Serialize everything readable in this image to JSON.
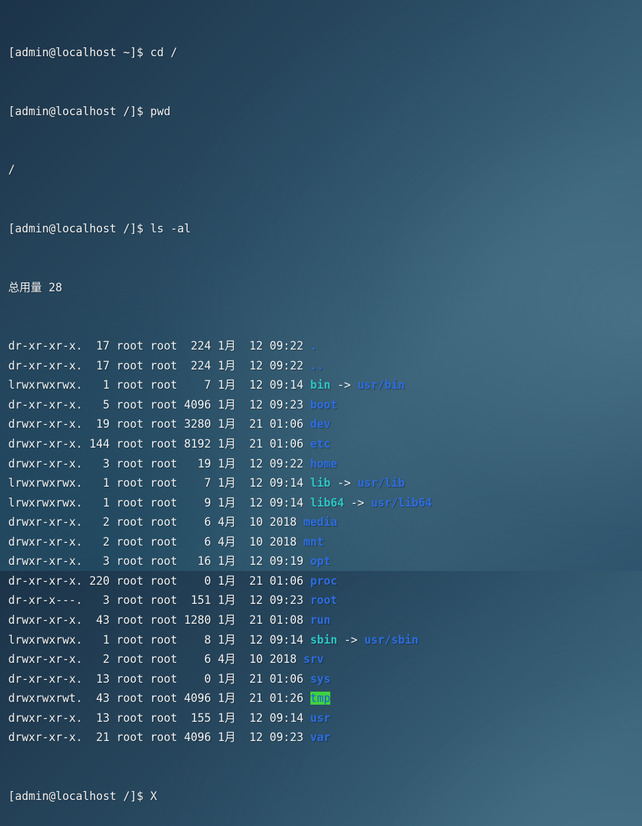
{
  "colors": {
    "directory": "#2e6de0",
    "symlink": "#2ec4c4",
    "sticky_bg": "#3fd23f",
    "text": "#f2f2f2"
  },
  "terminal": {
    "prompt_home": "[admin@localhost ~]$ ",
    "prompt_root": "[admin@localhost /]$ ",
    "cmd1": "cd /",
    "cmd2": "pwd",
    "pwd_output": "/",
    "cmd3": "ls -al",
    "total_label": "总用量 28",
    "final_input": "X",
    "entries": [
      {
        "meta": "dr-xr-xr-x.  17 root root  224 1月  12 09:22 ",
        "name": ".",
        "target": "",
        "kind": "dir"
      },
      {
        "meta": "dr-xr-xr-x.  17 root root  224 1月  12 09:22 ",
        "name": "..",
        "target": "",
        "kind": "dir"
      },
      {
        "meta": "lrwxrwxrwx.   1 root root    7 1月  12 09:14 ",
        "name": "bin",
        "target": "usr/bin",
        "kind": "link"
      },
      {
        "meta": "dr-xr-xr-x.   5 root root 4096 1月  12 09:23 ",
        "name": "boot",
        "target": "",
        "kind": "dir"
      },
      {
        "meta": "drwxr-xr-x.  19 root root 3280 1月  21 01:06 ",
        "name": "dev",
        "target": "",
        "kind": "dir"
      },
      {
        "meta": "drwxr-xr-x. 144 root root 8192 1月  21 01:06 ",
        "name": "etc",
        "target": "",
        "kind": "dir"
      },
      {
        "meta": "drwxr-xr-x.   3 root root   19 1月  12 09:22 ",
        "name": "home",
        "target": "",
        "kind": "dir"
      },
      {
        "meta": "lrwxrwxrwx.   1 root root    7 1月  12 09:14 ",
        "name": "lib",
        "target": "usr/lib",
        "kind": "link"
      },
      {
        "meta": "lrwxrwxrwx.   1 root root    9 1月  12 09:14 ",
        "name": "lib64",
        "target": "usr/lib64",
        "kind": "link"
      },
      {
        "meta": "drwxr-xr-x.   2 root root    6 4月  10 2018 ",
        "name": "media",
        "target": "",
        "kind": "dir"
      },
      {
        "meta": "drwxr-xr-x.   2 root root    6 4月  10 2018 ",
        "name": "mnt",
        "target": "",
        "kind": "dir"
      },
      {
        "meta": "drwxr-xr-x.   3 root root   16 1月  12 09:19 ",
        "name": "opt",
        "target": "",
        "kind": "dir"
      },
      {
        "meta": "dr-xr-xr-x. 220 root root    0 1月  21 01:06 ",
        "name": "proc",
        "target": "",
        "kind": "dir"
      },
      {
        "meta": "dr-xr-x---.   3 root root  151 1月  12 09:23 ",
        "name": "root",
        "target": "",
        "kind": "dir"
      },
      {
        "meta": "drwxr-xr-x.  43 root root 1280 1月  21 01:08 ",
        "name": "run",
        "target": "",
        "kind": "dir"
      },
      {
        "meta": "lrwxrwxrwx.   1 root root    8 1月  12 09:14 ",
        "name": "sbin",
        "target": "usr/sbin",
        "kind": "link"
      },
      {
        "meta": "drwxr-xr-x.   2 root root    6 4月  10 2018 ",
        "name": "srv",
        "target": "",
        "kind": "dir"
      },
      {
        "meta": "dr-xr-xr-x.  13 root root    0 1月  21 01:06 ",
        "name": "sys",
        "target": "",
        "kind": "dir"
      },
      {
        "meta": "drwxrwxrwt.  43 root root 4096 1月  21 01:26 ",
        "name": "tmp",
        "target": "",
        "kind": "sticky"
      },
      {
        "meta": "drwxr-xr-x.  13 root root  155 1月  12 09:14 ",
        "name": "usr",
        "target": "",
        "kind": "dir"
      },
      {
        "meta": "drwxr-xr-x.  21 root root 4096 1月  12 09:23 ",
        "name": "var",
        "target": "",
        "kind": "dir"
      }
    ]
  }
}
